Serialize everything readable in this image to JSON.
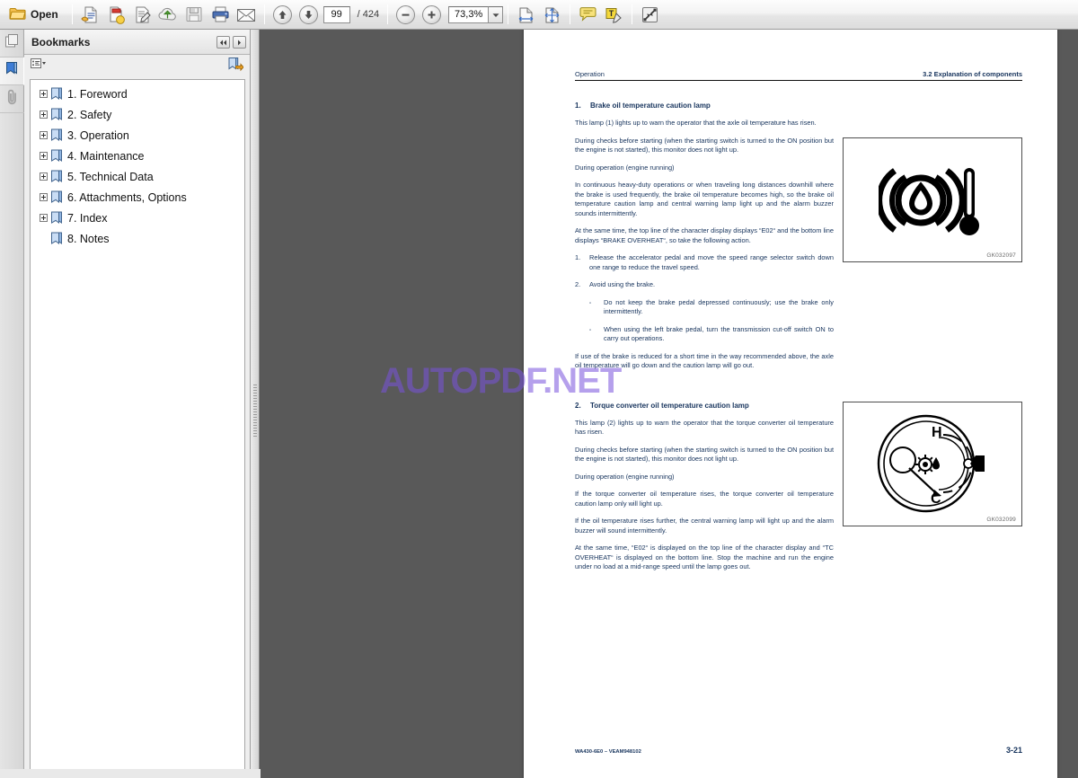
{
  "toolbar": {
    "open_label": "Open",
    "buttons": [
      {
        "name": "open-folder-icon",
        "label": "Open"
      },
      {
        "name": "create-pdf-icon",
        "label": "Create PDF"
      },
      {
        "name": "combine-files-icon",
        "label": "Combine Files"
      },
      {
        "name": "edit-pdf-icon",
        "label": "Edit PDF"
      },
      {
        "name": "upload-cloud-icon",
        "label": "Send to Cloud"
      },
      {
        "name": "save-icon",
        "label": "Save"
      },
      {
        "name": "print-icon",
        "label": "Print"
      },
      {
        "name": "email-icon",
        "label": "Email"
      }
    ],
    "nav": {
      "previous_page_label": "Previous Page",
      "next_page_label": "Next Page",
      "current_page": "99",
      "page_separator": "/",
      "total_pages": "424"
    },
    "zoom": {
      "zoom_out_label": "Zoom Out",
      "zoom_in_label": "Zoom In",
      "level": "73,3%",
      "dropdown_label": "Zoom presets"
    },
    "view_buttons": [
      {
        "name": "fit-width-icon",
        "label": "Fit Width"
      },
      {
        "name": "fit-page-icon",
        "label": "Fit Page"
      },
      {
        "name": "comment-icon",
        "label": "Add Sticky Note"
      },
      {
        "name": "highlight-text-icon",
        "label": "Highlight Text"
      },
      {
        "name": "fullscreen-icon",
        "label": "Full Screen"
      }
    ]
  },
  "rail": {
    "items": [
      {
        "name": "page-thumbnails-icon",
        "label": "Page Thumbnails",
        "selected": false
      },
      {
        "name": "bookmarks-icon",
        "label": "Bookmarks",
        "selected": true
      },
      {
        "name": "attachments-icon",
        "label": "Attachments",
        "selected": false
      }
    ]
  },
  "panel": {
    "title": "Bookmarks",
    "collapse_label": "Collapse",
    "expand_label": "Expand",
    "options_label": "Bookmark Options",
    "new_bookmark_label": "New Bookmark",
    "bookmarks": [
      {
        "label": "1. Foreword",
        "expandable": true
      },
      {
        "label": "2. Safety",
        "expandable": true
      },
      {
        "label": "3. Operation",
        "expandable": true
      },
      {
        "label": "4. Maintenance",
        "expandable": true
      },
      {
        "label": "5. Technical Data",
        "expandable": true
      },
      {
        "label": "6. Attachments, Options",
        "expandable": true
      },
      {
        "label": "7. Index",
        "expandable": true
      },
      {
        "label": "8. Notes",
        "expandable": false
      }
    ]
  },
  "document": {
    "header_left": "Operation",
    "header_right": "3.2  Explanation of components",
    "footer_left": "WA430-6E0 – VEAM948102",
    "footer_right": "3-21",
    "watermark": "AUTOPDF.NET",
    "sections": [
      {
        "number": "1.",
        "title": "Brake oil temperature caution lamp",
        "figure_caption": "GK032097",
        "figure_name": "brake-oil-temperature-caution-lamp-symbol",
        "paragraphs": [
          "This lamp (1) lights up to warn the operator that the axle oil temperature has risen.",
          "During checks before starting (when the starting switch is turned to the ON position but the engine is not started), this monitor does not light up.",
          "During operation (engine running)",
          "In continuous heavy-duty operations or when traveling long distances downhill where the brake is used frequently, the brake oil temperature becomes high, so the brake oil temperature caution lamp and central warning lamp light up and the alarm buzzer sounds intermittently.",
          "At the same time, the top line of the character display displays “E02“ and the bottom line displays “BRAKE OVERHEAT“, so take the following action."
        ],
        "numbered_items": [
          {
            "marker": "1.",
            "text": "Release the accelerator pedal and move the speed range selector switch down one range to reduce the travel speed."
          },
          {
            "marker": "2.",
            "text": "Avoid using the brake."
          }
        ],
        "sub_items": [
          {
            "marker": "▫",
            "text": "Do not keep the brake pedal depressed continuously; use the brake only intermittently."
          },
          {
            "marker": "▫",
            "text": "When using the left brake pedal, turn the transmission cut-off switch ON to carry out operations."
          }
        ],
        "closing_paragraph": "If use of the brake is reduced for a short time in the way recommended above, the axle oil temperature will go down and the caution lamp will go out."
      },
      {
        "number": "2.",
        "title": "Torque converter oil temperature caution lamp",
        "figure_caption": "GK032099",
        "figure_name": "torque-converter-oil-temperature-gauge",
        "paragraphs": [
          "This lamp (2) lights up to warn the operator that the torque converter oil temperature has risen.",
          "During checks before starting (when the starting switch is turned to the ON position but the engine is not started), this monitor does not light up.",
          "During operation (engine running)",
          "If the torque converter oil temperature rises, the torque converter oil temperature caution lamp only will light up.",
          "If the oil temperature rises further, the central warning lamp will light up and the alarm buzzer will sound intermittently.",
          "At the same time, “E02“ is displayed on the top line of the character display and “TC OVERHEAT“ is displayed on the bottom line. Stop the machine and run the engine under no load at a mid-range speed until the lamp goes out."
        ],
        "numbered_items": [],
        "sub_items": [],
        "closing_paragraph": ""
      }
    ]
  }
}
